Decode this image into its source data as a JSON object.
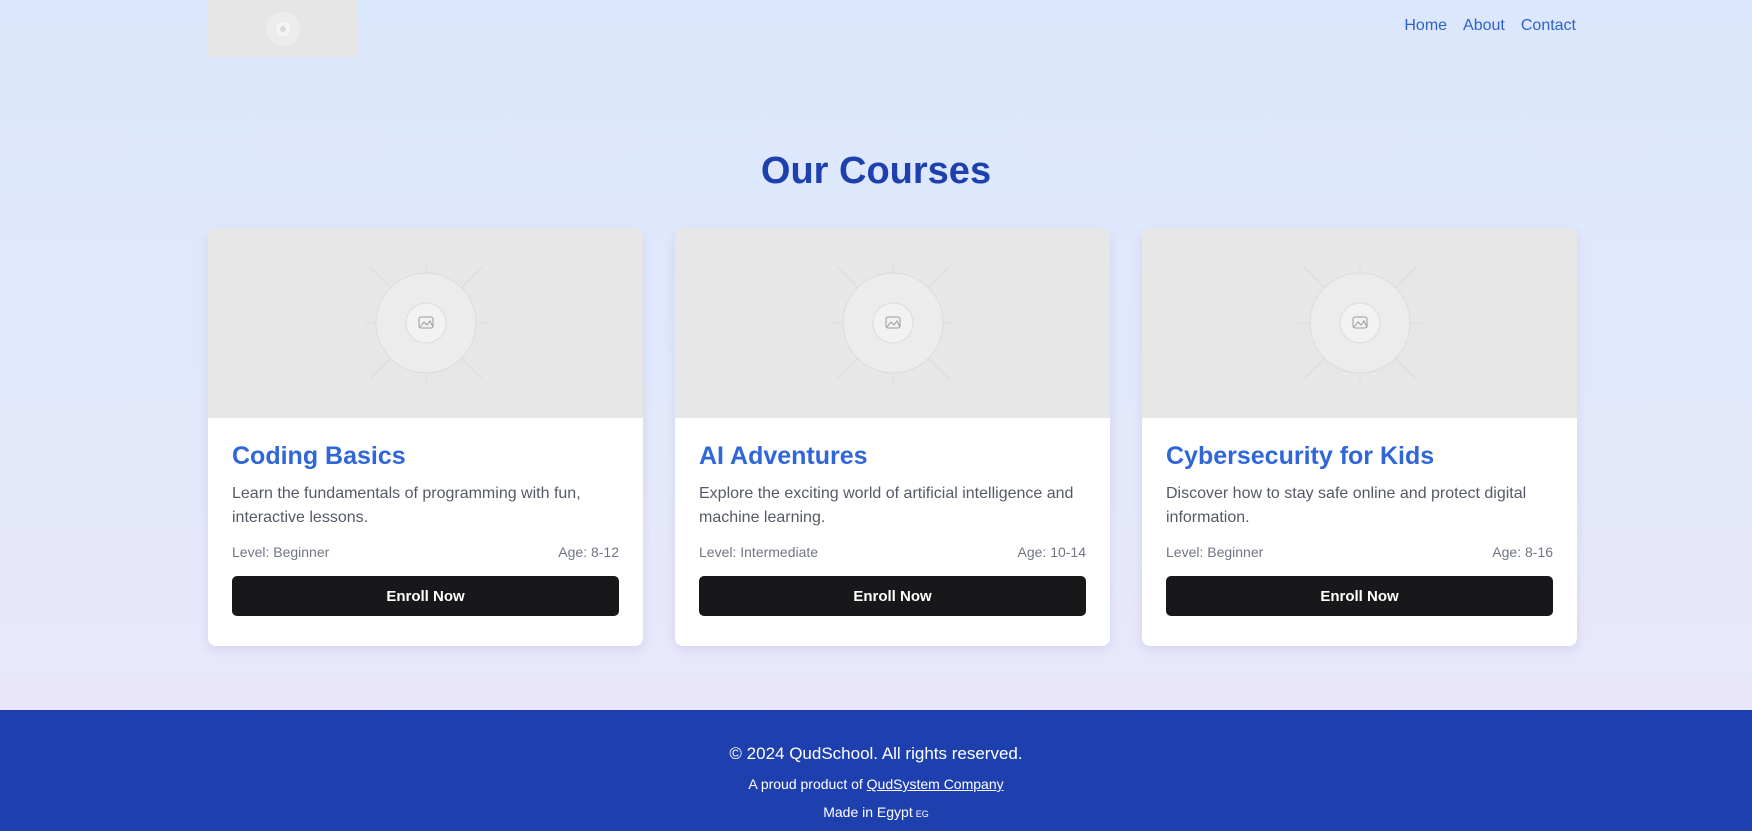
{
  "nav": {
    "home": "Home",
    "about": "About",
    "contact": "Contact"
  },
  "section": {
    "title": "Our Courses"
  },
  "courses": [
    {
      "title": "Coding Basics",
      "description": "Learn the fundamentals of programming with fun, interactive lessons.",
      "level": "Level: Beginner",
      "age": "Age: 8-12",
      "button": "Enroll Now"
    },
    {
      "title": "AI Adventures",
      "description": "Explore the exciting world of artificial intelligence and machine learning.",
      "level": "Level: Intermediate",
      "age": "Age: 10-14",
      "button": "Enroll Now"
    },
    {
      "title": "Cybersecurity for Kids",
      "description": "Discover how to stay safe online and protect digital information.",
      "level": "Level: Beginner",
      "age": "Age: 8-16",
      "button": "Enroll Now"
    }
  ],
  "footer": {
    "copyright": "© 2024 QudSchool. All rights reserved.",
    "proud_prefix": "A proud product of ",
    "company_link": "QudSystem Company",
    "made_in": "Made in Egypt",
    "flag": "EG"
  },
  "colors": {
    "brand_blue": "#1e40af",
    "link_blue": "#2f62c9",
    "button_dark": "#18181b"
  },
  "icons": {
    "logo": "image-placeholder-icon",
    "card_image": "image-placeholder-icon"
  }
}
